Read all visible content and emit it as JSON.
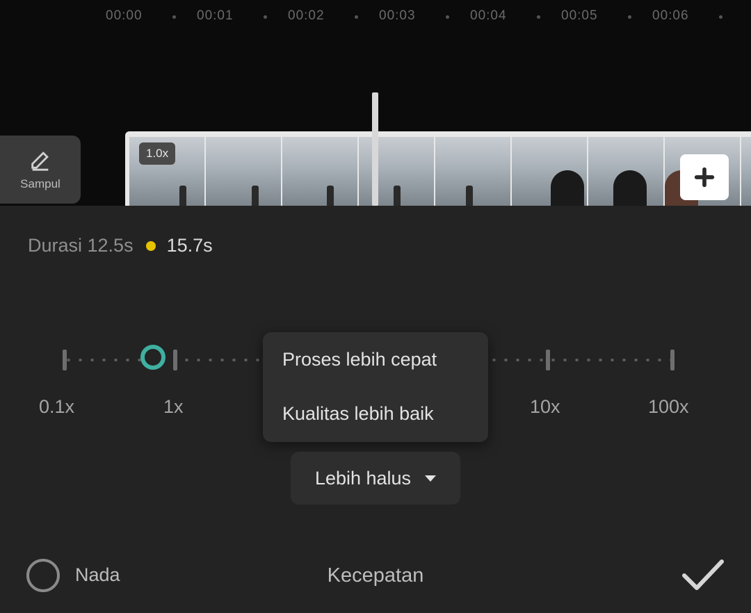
{
  "timeline": {
    "ticks": [
      "00:00",
      "00:01",
      "00:02",
      "00:03",
      "00:04",
      "00:05",
      "00:06"
    ],
    "cover_label": "Sampul",
    "clip_speed_badge": "1.0x"
  },
  "speed_panel": {
    "duration_label": "Durasi 12.5s",
    "duration_new": "15.7s",
    "scale_labels": [
      "0.1x",
      "1x",
      "10x",
      "100x"
    ],
    "current_speed_fraction": 0.148,
    "menu_options": [
      "Proses lebih cepat",
      "Kualitas lebih baik"
    ],
    "quality_value": "Lebih halus",
    "knob_color": "#3fb0a0",
    "accent_yellow": "#e6c200"
  },
  "footer": {
    "pitch_label": "Nada",
    "title": "Kecepatan",
    "confirm_icon": "check-icon"
  }
}
